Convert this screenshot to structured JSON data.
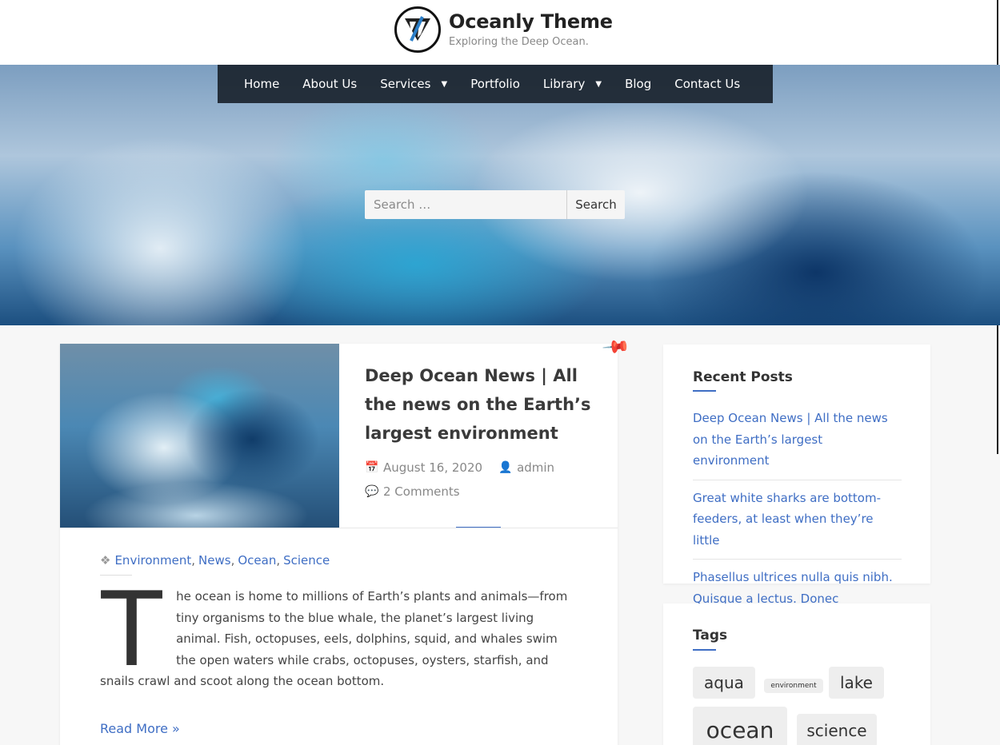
{
  "site": {
    "title": "Oceanly Theme",
    "tagline": "Exploring the Deep Ocean.",
    "logo_icon": "triangle-logo-icon"
  },
  "nav": {
    "items": [
      {
        "label": "Home",
        "has_dropdown": false
      },
      {
        "label": "About Us",
        "has_dropdown": false
      },
      {
        "label": "Services",
        "has_dropdown": true
      },
      {
        "label": "Portfolio",
        "has_dropdown": false
      },
      {
        "label": "Library",
        "has_dropdown": true
      },
      {
        "label": "Blog",
        "has_dropdown": false
      },
      {
        "label": "Contact Us",
        "has_dropdown": false
      }
    ],
    "chevron": "⌄"
  },
  "search": {
    "placeholder": "Search …",
    "button_label": "Search"
  },
  "post": {
    "title": "Deep Ocean News | All the news on the Earth’s largest environment",
    "date": "August 16, 2020",
    "author": "admin",
    "comments": "2 Comments",
    "categories": [
      "Environment",
      "News",
      "Ocean",
      "Science"
    ],
    "dropcap": "T",
    "excerpt": "he ocean is home to millions of Earth’s plants and animals—from tiny organisms to the blue whale, the planet’s largest living animal. Fish, octopuses, eels, dolphins, squid, and whales swim the open waters while crabs, octopuses, oysters, starfish, and snails crawl and scoot along the ocean bottom.",
    "read_more": "Read More »",
    "sticky_icon": "pin-icon"
  },
  "sidebar": {
    "recent_posts": {
      "title": "Recent Posts",
      "items": [
        "Deep Ocean News | All the news on the Earth’s largest environment",
        "Great white sharks are bottom-feeders, at least when they’re little",
        "Phasellus ultrices nulla quis nibh. Quisque a lectus. Donec"
      ]
    },
    "tags": {
      "title": "Tags",
      "items": [
        "aqua",
        "environment",
        "lake",
        "ocean",
        "science"
      ]
    }
  },
  "colors": {
    "accent": "#3f6ec4",
    "nav_bg": "#141c26"
  }
}
